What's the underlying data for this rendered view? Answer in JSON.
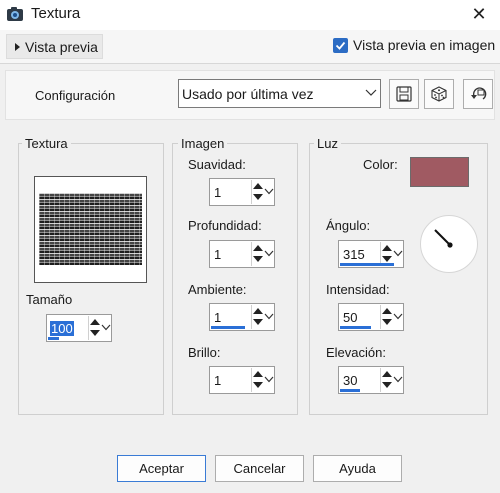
{
  "window": {
    "title": "Textura"
  },
  "preview": {
    "toggle_label": "Vista previa",
    "checkbox_label": "Vista previa en imagen",
    "checked": true
  },
  "config": {
    "label": "Configuración",
    "selected": "Usado por última vez"
  },
  "groups": {
    "textura": {
      "title": "Textura",
      "size_label": "Tamaño",
      "size_value": "100",
      "size_fill": 0.18
    },
    "imagen": {
      "title": "Imagen",
      "suavidad_label": "Suavidad:",
      "suavidad_value": "1",
      "profundidad_label": "Profundidad:",
      "profundidad_value": "1",
      "ambiente_label": "Ambiente:",
      "ambiente_value": "1",
      "ambiente_fill": 0.55,
      "brillo_label": "Brillo:",
      "brillo_value": "1"
    },
    "luz": {
      "title": "Luz",
      "color_label": "Color:",
      "color_value": "#a05a62",
      "angulo_label": "Ángulo:",
      "angulo_value": "315",
      "angulo_fill": 0.87,
      "intensidad_label": "Intensidad:",
      "intensidad_value": "50",
      "intensidad_fill": 0.5,
      "elevacion_label": "Elevación:",
      "elevacion_value": "30",
      "elevacion_fill": 0.33
    }
  },
  "buttons": {
    "accept": "Aceptar",
    "cancel": "Cancelar",
    "help": "Ayuda"
  },
  "icons": {
    "app": "app-camera-icon",
    "close": "close-icon",
    "save": "save-icon",
    "random": "dice-icon",
    "reset": "reset-icon"
  }
}
